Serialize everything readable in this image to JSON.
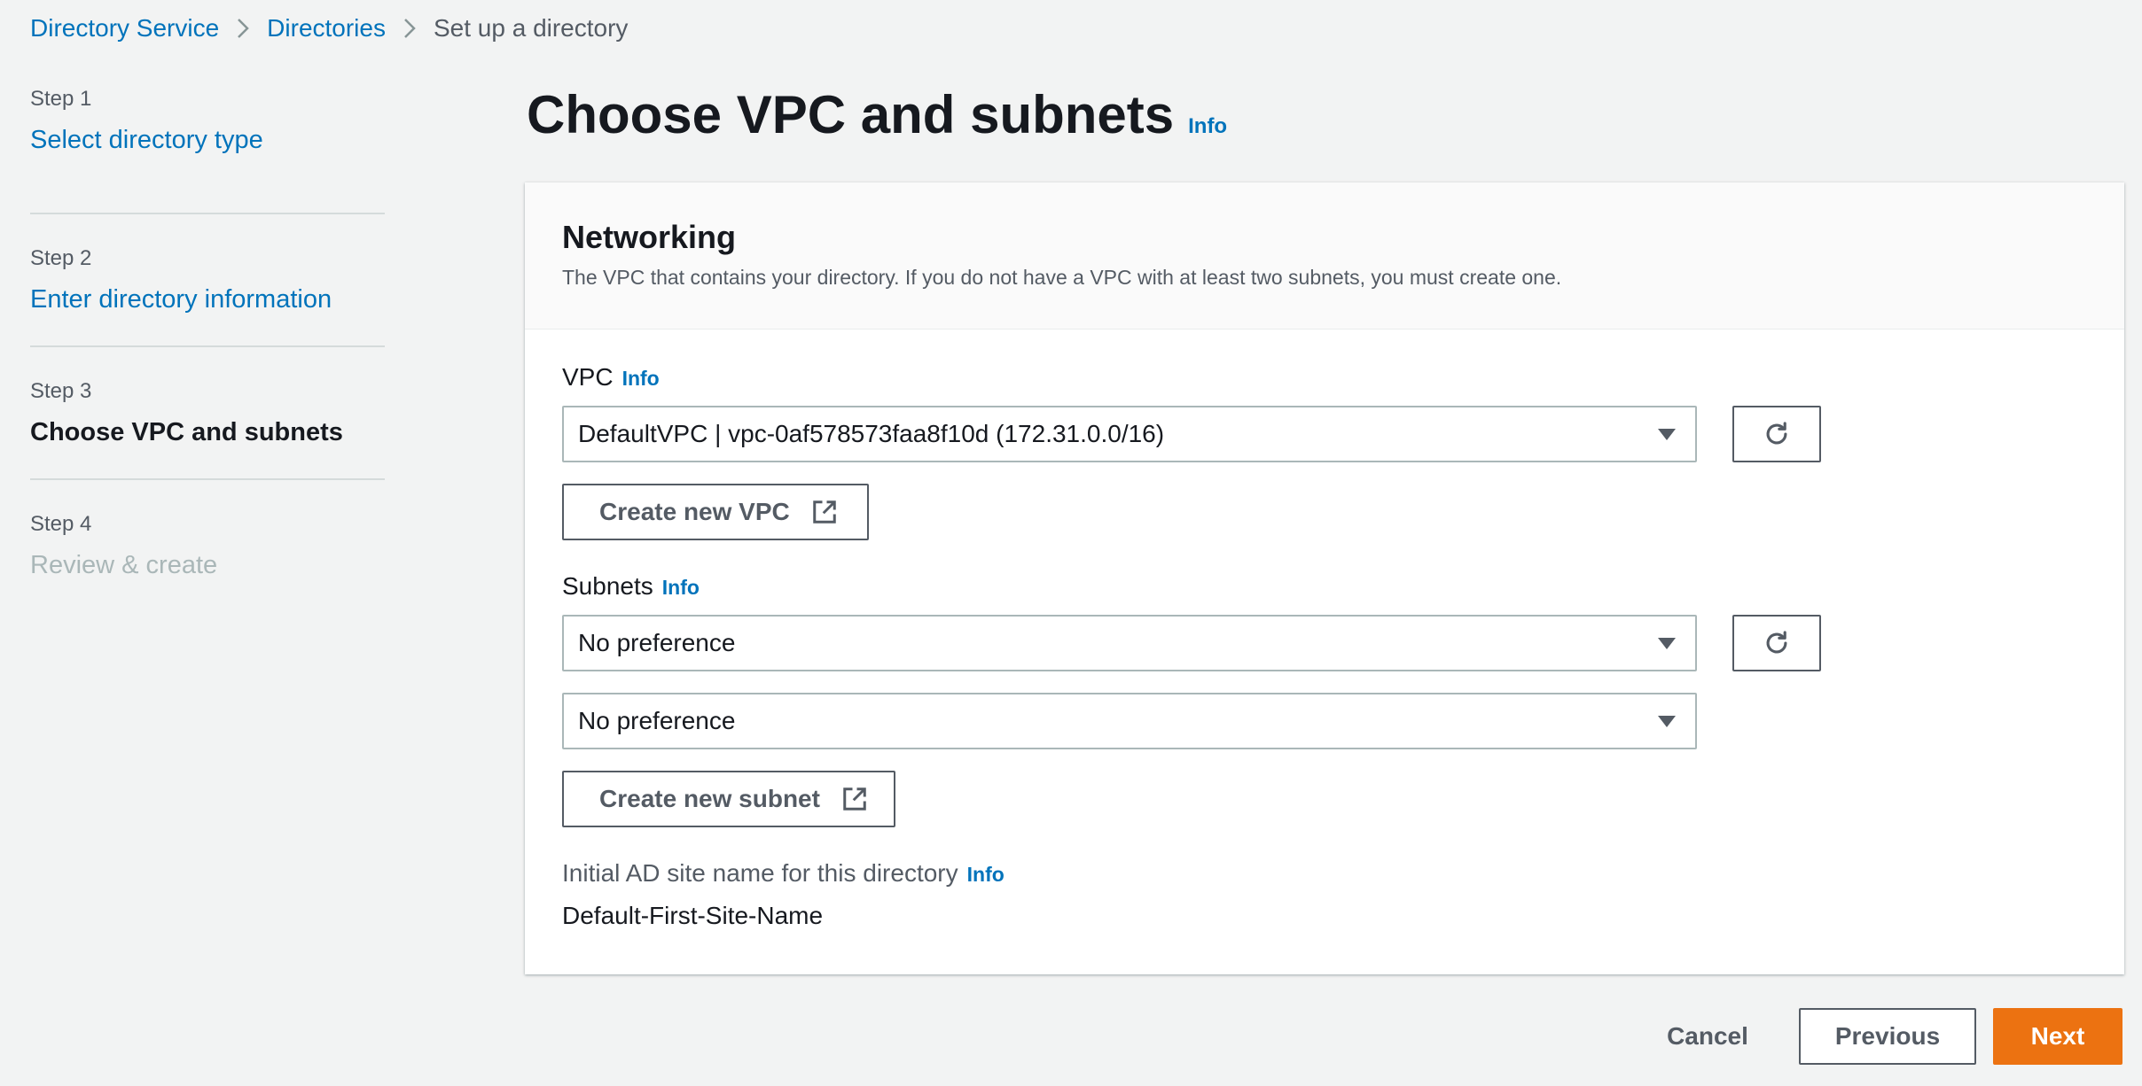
{
  "breadcrumb": {
    "items": [
      "Directory Service",
      "Directories"
    ],
    "current": "Set up a directory"
  },
  "steps": [
    {
      "num": "Step 1",
      "label": "Select directory type",
      "state": "link"
    },
    {
      "num": "Step 2",
      "label": "Enter directory information",
      "state": "link"
    },
    {
      "num": "Step 3",
      "label": "Choose VPC and subnets",
      "state": "active"
    },
    {
      "num": "Step 4",
      "label": "Review & create",
      "state": "disabled"
    }
  ],
  "page": {
    "title": "Choose VPC and subnets",
    "info": "Info"
  },
  "networking": {
    "heading": "Networking",
    "description": "The VPC that contains your directory. If you do not have a VPC with at least two subnets, you must create one.",
    "vpc_label": "VPC",
    "vpc_info": "Info",
    "vpc_value": "DefaultVPC | vpc-0af578573faa8f10d (172.31.0.0/16)",
    "create_vpc_label": "Create new VPC",
    "subnets_label": "Subnets",
    "subnets_info": "Info",
    "subnet_1_value": "No preference",
    "subnet_2_value": "No preference",
    "create_subnet_label": "Create new subnet",
    "ad_site_label": "Initial AD site name for this directory",
    "ad_site_info": "Info",
    "ad_site_value": "Default-First-Site-Name"
  },
  "footer": {
    "cancel": "Cancel",
    "previous": "Previous",
    "next": "Next"
  },
  "colors": {
    "link": "#0073bb",
    "primary_button": "#ec7211",
    "background": "#f2f3f3"
  },
  "icons": [
    "chevron-right-icon",
    "refresh-icon",
    "external-link-icon",
    "caret-down-icon"
  ]
}
